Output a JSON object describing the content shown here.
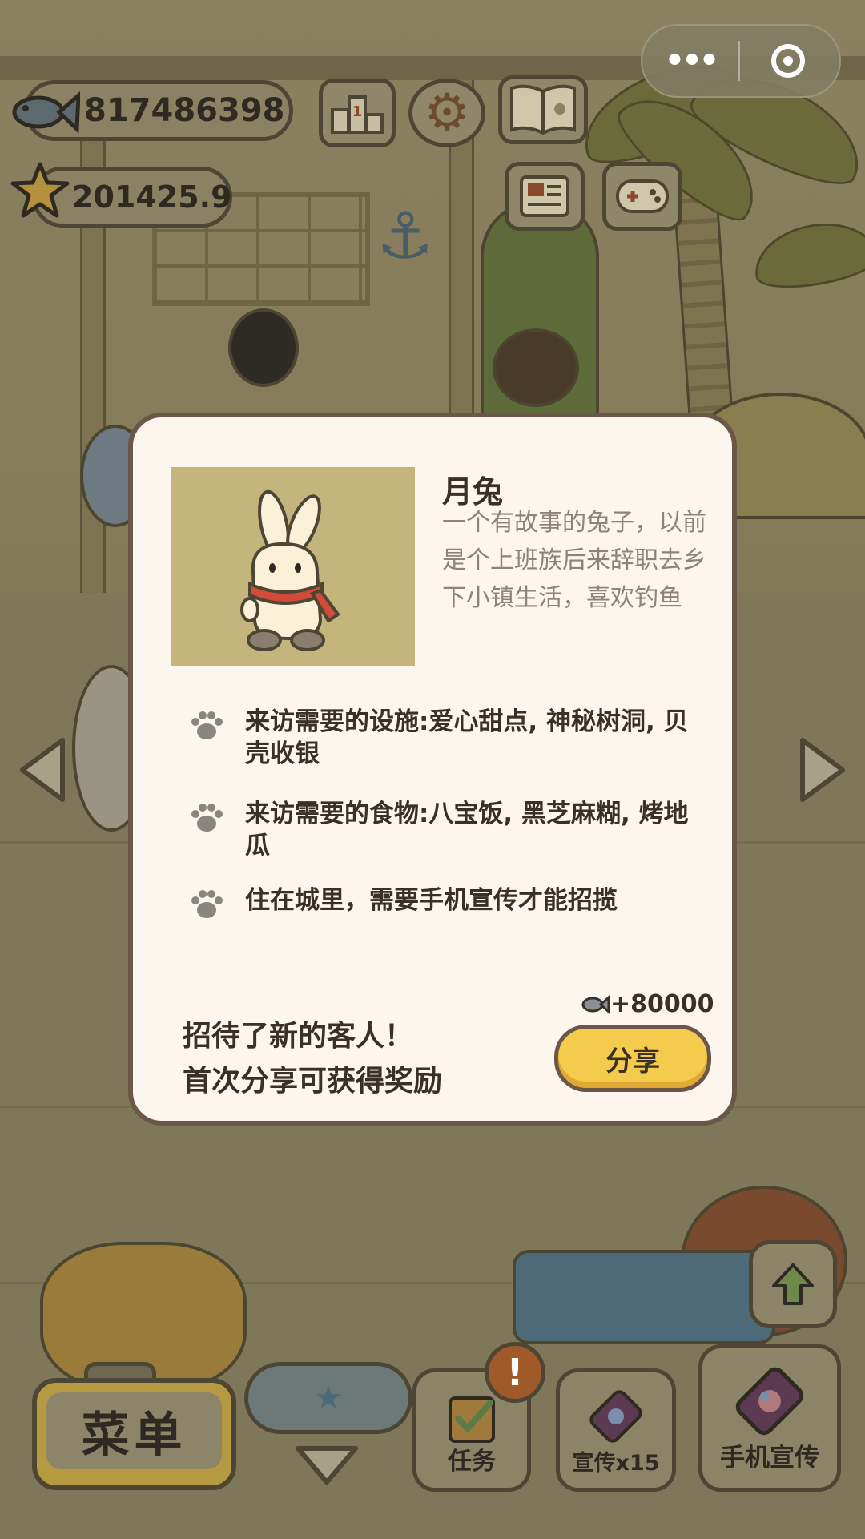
{
  "hud": {
    "fish_count": "817486398",
    "star_count": "201425.9",
    "icons": [
      "fish-icon",
      "star-icon",
      "leaderboard-icon",
      "settings-gear-icon",
      "paw-book-icon",
      "newspaper-icon",
      "gamepad-icon"
    ]
  },
  "mini_program": {
    "more_glyph": "•••",
    "close_icon": "target-icon"
  },
  "card": {
    "name": "月兔",
    "description": "一个有故事的兔子，以前是个上班族后来辞职去乡下小镇生活，喜欢钓鱼",
    "requirements": [
      "来访需要的设施:爱心甜点, 神秘树洞, 贝壳收银",
      "来访需要的食物:八宝饭, 黑芝麻糊, 烤地瓜",
      "住在城里，需要手机宣传才能招揽"
    ],
    "reward": "+80000",
    "cta_line1": "招待了新的客人！",
    "cta_line2": "首次分享可获得奖励",
    "share_label": "分享"
  },
  "bottom": {
    "menu_label": "菜单",
    "tasks_label": "任务",
    "promo_label": "宣传x15",
    "phone_promo_label": "手机宣传",
    "badge": "!"
  },
  "colors": {
    "share_button": "#f4cb4c",
    "card_bg": "#fcf6ee",
    "card_border": "#6b5747",
    "portrait_bg": "#c4b57d"
  }
}
